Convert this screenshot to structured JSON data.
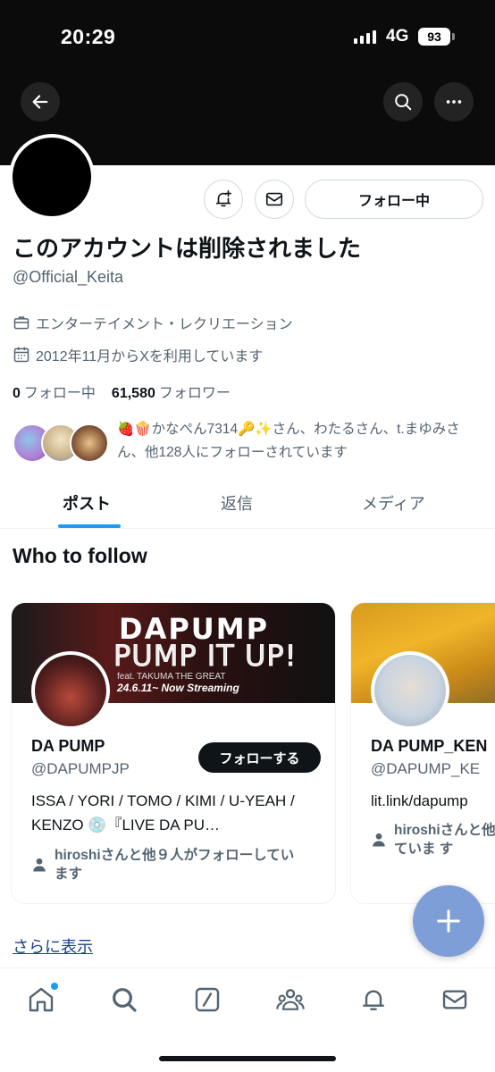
{
  "status_bar": {
    "time": "20:29",
    "network": "4G",
    "battery": "93"
  },
  "profile": {
    "display_name": "このアカウントは削除されました",
    "handle": "@Official_Keita",
    "category": "エンターテイメント・レクリエーション",
    "joined": "2012年11月からXを利用しています",
    "following_count": "0",
    "following_label": "フォロー中",
    "followers_count": "61,580",
    "followers_label": "フォロワー",
    "follow_button_label": "フォロー中",
    "followed_by_text": "🍓🍿かなぺん7314🔑✨さん、わたるさん、t.まゆみさん、他128人にフォローされています"
  },
  "tabs": [
    {
      "label": "ポスト",
      "active": true
    },
    {
      "label": "返信",
      "active": false
    },
    {
      "label": "メディア",
      "active": false
    }
  ],
  "who_to_follow": {
    "title": "Who to follow",
    "cards": [
      {
        "name": "DA PUMP",
        "handle": "@DAPUMPJP",
        "follow_label": "フォローする",
        "bio": "ISSA / YORI / TOMO / KIMI / U-YEAH / KENZO 💿『LIVE DA PU…",
        "social": "hiroshiさんと他９人がフォローしています",
        "banner_title": "DAPUMP",
        "banner_subtitle": "PUMP IT UP!",
        "banner_feat": "feat. TAKUMA THE GREAT",
        "banner_date": "24.6.11~ Now Streaming"
      },
      {
        "name": "DA PUMP_KEN",
        "handle": "@DAPUMP_KE",
        "bio": "lit.link/dapump",
        "social": "hiroshiさんと他 ていま す"
      }
    ],
    "show_more": "さらに表示"
  },
  "icons": {
    "back": "back-arrow-icon",
    "search": "search-icon",
    "more": "more-icon",
    "notify": "bell-plus-icon",
    "message": "mail-icon",
    "category": "briefcase-icon",
    "joined": "calendar-icon",
    "person": "person-icon",
    "compose": "plus-icon",
    "nav": [
      "home-icon",
      "search-icon",
      "grok-icon",
      "communities-icon",
      "bell-icon",
      "mail-icon"
    ]
  },
  "colors": {
    "accent": "#1d9bf0",
    "fab": "#7e9ed8",
    "text": "#0f1419",
    "muted": "#536471"
  }
}
